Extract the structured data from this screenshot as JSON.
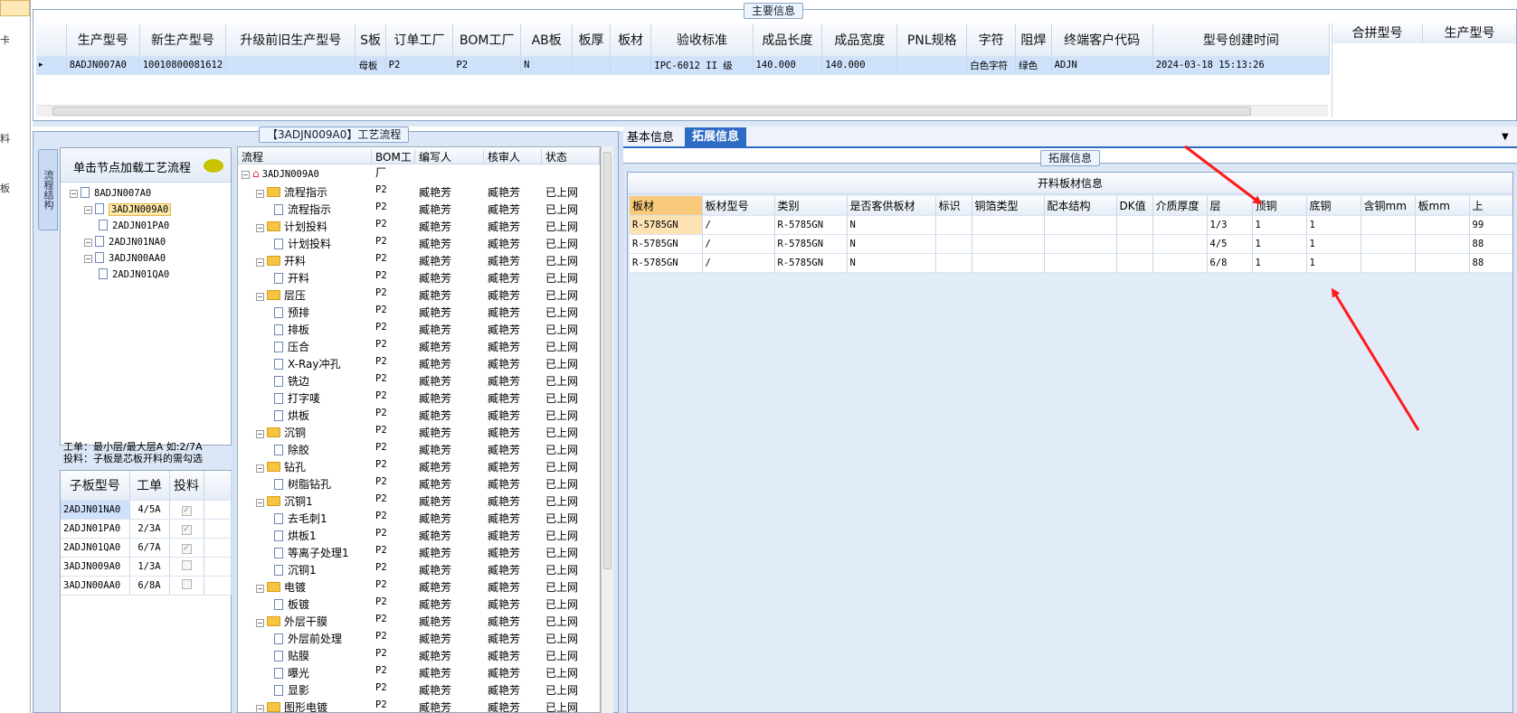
{
  "left_strip": {
    "labels": [
      "卡",
      "料",
      "板"
    ]
  },
  "main_info": {
    "title": "主要信息",
    "columns": [
      "生产型号",
      "新生产型号",
      "升级前旧生产型号",
      "S板",
      "订单工厂",
      "BOM工厂",
      "AB板",
      "板厚",
      "板材",
      "验收标准",
      "成品长度",
      "成品宽度",
      "PNL规格",
      "字符",
      "阻焊",
      "终端客户代码",
      "型号创建时间"
    ],
    "row": [
      "8ADJN007A0",
      "10010800081612",
      "",
      "母板",
      "P2",
      "P2",
      "N",
      "",
      "",
      "IPC-6012 II 级",
      "140.000",
      "140.000",
      "",
      "白色字符",
      "绿色",
      "ADJN",
      "2024-03-18 15:13:26"
    ],
    "right_columns": [
      "合拼型号",
      "生产型号"
    ]
  },
  "process_panel": {
    "title": "【3ADJN009A0】工艺流程",
    "side_tab": "流程结构",
    "hint": "单击节点加载工艺流程",
    "tree": [
      {
        "label": "8ADJN007A0",
        "level": 0
      },
      {
        "label": "3ADJN009A0",
        "level": 1,
        "selected": true
      },
      {
        "label": "2ADJN01PA0",
        "level": 2
      },
      {
        "label": "2ADJN01NA0",
        "level": 1
      },
      {
        "label": "3ADJN00AA0",
        "level": 1
      },
      {
        "label": "2ADJN01QA0",
        "level": 2
      }
    ],
    "note1": "工单：最小层/最大层A 如:2/7A",
    "note2": "投料：子板是芯板开料的需勾选",
    "sub_columns": [
      "子板型号",
      "工单",
      "投料"
    ],
    "sub_rows": [
      {
        "model": "2ADJN01NA0",
        "order": "4/5A",
        "feed": true
      },
      {
        "model": "2ADJN01PA0",
        "order": "2/3A",
        "feed": true
      },
      {
        "model": "2ADJN01QA0",
        "order": "6/7A",
        "feed": true
      },
      {
        "model": "3ADJN009A0",
        "order": "1/3A",
        "feed": false
      },
      {
        "model": "3ADJN00AA0",
        "order": "6/8A",
        "feed": false
      }
    ]
  },
  "flow": {
    "columns": [
      "流程",
      "BOM工厂",
      "编写人",
      "核审人",
      "状态"
    ],
    "root": "3ADJN009A0",
    "rows": [
      {
        "name": "流程指示",
        "type": "folder"
      },
      {
        "name": "流程指示",
        "type": "doc"
      },
      {
        "name": "计划投料",
        "type": "folder"
      },
      {
        "name": "计划投料",
        "type": "doc"
      },
      {
        "name": "开料",
        "type": "folder"
      },
      {
        "name": "开料",
        "type": "doc"
      },
      {
        "name": "层压",
        "type": "folder"
      },
      {
        "name": "预排",
        "type": "doc"
      },
      {
        "name": "排板",
        "type": "doc"
      },
      {
        "name": "压合",
        "type": "doc"
      },
      {
        "name": "X-Ray冲孔",
        "type": "doc"
      },
      {
        "name": "铣边",
        "type": "doc"
      },
      {
        "name": "打字唛",
        "type": "doc"
      },
      {
        "name": "烘板",
        "type": "doc"
      },
      {
        "name": "沉铜",
        "type": "folder"
      },
      {
        "name": "除胶",
        "type": "doc"
      },
      {
        "name": "钻孔",
        "type": "folder"
      },
      {
        "name": "树脂钻孔",
        "type": "doc"
      },
      {
        "name": "沉铜1",
        "type": "folder"
      },
      {
        "name": "去毛刺1",
        "type": "doc"
      },
      {
        "name": "烘板1",
        "type": "doc"
      },
      {
        "name": "等离子处理1",
        "type": "doc"
      },
      {
        "name": "沉铜1",
        "type": "doc"
      },
      {
        "name": "电镀",
        "type": "folder"
      },
      {
        "name": "板镀",
        "type": "doc"
      },
      {
        "name": "外层干膜",
        "type": "folder"
      },
      {
        "name": "外层前处理",
        "type": "doc"
      },
      {
        "name": "贴膜",
        "type": "doc"
      },
      {
        "name": "曝光",
        "type": "doc"
      },
      {
        "name": "显影",
        "type": "doc"
      },
      {
        "name": "图形电镀",
        "type": "folder"
      }
    ],
    "factory": "P2",
    "writer": "臧艳芳",
    "reviewer": "臧艳芳",
    "status": "已上网"
  },
  "tabs": {
    "basic": "基本信息",
    "extended": "拓展信息"
  },
  "ext": {
    "group_title": "拓展信息",
    "table_title": "开料板材信息",
    "columns": [
      "板材",
      "板材型号",
      "类别",
      "是否客供板材",
      "标识",
      "铜箔类型",
      "配本结构",
      "DK值",
      "介质厚度",
      "层",
      "顶铜",
      "底铜",
      "含铜mm",
      "板mm",
      "上"
    ],
    "rows": [
      [
        "R-5785GN",
        "/",
        "R-5785GN",
        "N",
        "",
        "",
        "",
        "",
        "",
        "1/3",
        "1",
        "1",
        "",
        "",
        "99"
      ],
      [
        "R-5785GN",
        "/",
        "R-5785GN",
        "N",
        "",
        "",
        "",
        "",
        "",
        "4/5",
        "1",
        "1",
        "",
        "",
        "88"
      ],
      [
        "R-5785GN",
        "/",
        "R-5785GN",
        "N",
        "",
        "",
        "",
        "",
        "",
        "6/8",
        "1",
        "1",
        "",
        "",
        "88"
      ]
    ]
  },
  "colors": {
    "selected": "#cfe2fb",
    "tab_active": "#2e6bc4",
    "arrow": "#ff1a1a",
    "header": "#e6edf7"
  }
}
